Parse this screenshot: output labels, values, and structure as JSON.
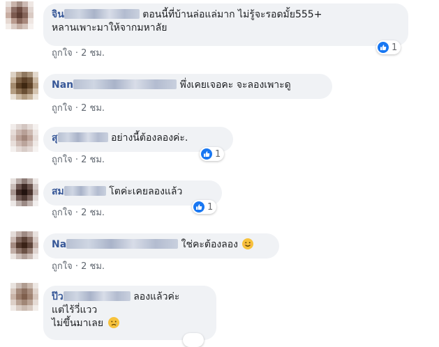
{
  "comments": [
    {
      "author": "จิน",
      "text_line1": "ตอนนี้ที่บ้านล่อแล่มาก ไม่รู้จะรอดมั้ย555+",
      "text_line2": "หลานเพาะมาให้จากมหาลัย",
      "like_label": "ถูกใจ",
      "time": "2 ชม.",
      "reaction_count": "1",
      "avatar_colors": [
        "#e8e0dc",
        "#c9b4ab",
        "#a58f86",
        "#cbb9b3",
        "#efe7e3",
        "#d7c2ba",
        "#8d6f66",
        "#6e4c42",
        "#9a7c72",
        "#e1d5d0",
        "#c7ada2",
        "#7c5a4f",
        "#5d3d33",
        "#846459",
        "#d9cac3",
        "#e6d9d2",
        "#b99b8f",
        "#8a695d",
        "#a8887c",
        "#efe6e2",
        "#f3ede9",
        "#dacbc4",
        "#c4aea4",
        "#d5c4bc",
        "#f6f1ee"
      ]
    },
    {
      "author": "Nan",
      "text_line1": "พึ่งเคยเจอคะ จะลองเพาะดู",
      "like_label": "ถูกใจ",
      "time": "2 ชม.",
      "avatar_colors": [
        "#dcd1c4",
        "#b49f87",
        "#8f7860",
        "#a8937b",
        "#e2d8cc",
        "#c6b29b",
        "#7a5f44",
        "#5d4128",
        "#6f553b",
        "#cdbba6",
        "#a38a6e",
        "#5b3f24",
        "#3f2812",
        "#604429",
        "#b69f85",
        "#b59e83",
        "#8a6e51",
        "#6a4f34",
        "#8c7257",
        "#d4c4b1",
        "#e9e1d7",
        "#cbb9a4",
        "#b19b81",
        "#c7b49d",
        "#ece5dc"
      ]
    },
    {
      "author": "สุ",
      "text_line1": "อย่างนี้ต้องลองค่ะ.",
      "like_label": "ถูกใจ",
      "time": "2 ชม.",
      "reaction_count": "1",
      "avatar_colors": [
        "#f1ecea",
        "#e0d6d2",
        "#d3c6c1",
        "#e4dbd7",
        "#f5f1ef",
        "#e6dcd8",
        "#c9b5ae",
        "#b8a097",
        "#cdbab2",
        "#ede6e3",
        "#dccec9",
        "#b99f95",
        "#a2867b",
        "#bfa59b",
        "#e6dcd8",
        "#e8dfdb",
        "#cdbab3",
        "#bba59c",
        "#d0beb7",
        "#efe9e6",
        "#f4f0ee",
        "#e4dad6",
        "#d8ccc7",
        "#e3d9d5",
        "#f6f3f1"
      ]
    },
    {
      "author": "สม",
      "text_line1": "โตค่ะเคยลองแล้ว",
      "like_label": "ถูกใจ",
      "time": "2 ชม.",
      "reaction_count": "1",
      "avatar_colors": [
        "#e6e0de",
        "#b7aaa6",
        "#8c7a75",
        "#b4a6a1",
        "#ece7e5",
        "#c9bdb9",
        "#6b5550",
        "#3e2a25",
        "#6a544e",
        "#d2c8c5",
        "#a89691",
        "#3c2722",
        "#22130f",
        "#4a342e",
        "#c2b4b0",
        "#c8bcb8",
        "#6e5853",
        "#4f3a34",
        "#7b6660",
        "#e1dad8",
        "#ece8e6",
        "#bdb1ad",
        "#9b8a85",
        "#c0b3af",
        "#f1eeed"
      ]
    },
    {
      "author": "Na",
      "text_line1": "ใช่คะต้องลอง",
      "like_label": "ถูกใจ",
      "time": "2 ชม.",
      "avatar_colors": [
        "#e4dcd9",
        "#c0afa9",
        "#9f8b84",
        "#bba9a2",
        "#e8e1de",
        "#cbbab4",
        "#7f665d",
        "#5c4237",
        "#83695f",
        "#d8cbc6",
        "#a48b82",
        "#543a2f",
        "#3a2217",
        "#5e443a",
        "#c6b3ac",
        "#c2afa8",
        "#8f766c",
        "#6c5246",
        "#947b71",
        "#dfd4d0",
        "#ebe5e2",
        "#cdbfba",
        "#b3a19a",
        "#cbbcb6",
        "#f0ebe9"
      ]
    },
    {
      "author": "ป๊ว",
      "text_line1": "ลองแล้วค่ะ",
      "text_line2": "แต่ไร้วี่แวว",
      "text_line3": "ไม่ขึ้นมาเลย",
      "avatar_colors": [
        "#e9e3df",
        "#cbbdb5",
        "#b09c90",
        "#cab9ae",
        "#ede7e3",
        "#d7c8bf",
        "#a58b7c",
        "#8c6f5f",
        "#a98f80",
        "#e0d4cd",
        "#c9b4a8",
        "#9a7c6b",
        "#7f5f4d",
        "#9f8271",
        "#d6c6bd",
        "#ddd0c8",
        "#b7a092",
        "#a18777",
        "#baa395",
        "#e5dbd5",
        "#efe9e5",
        "#d9ccc4",
        "#cbbbb1",
        "#d8cac1",
        "#f2ede9"
      ]
    }
  ],
  "colors": {
    "author": "#385898",
    "bubble": "#f0f2f5",
    "meta": "#606770",
    "like_blue": "#1877f2"
  }
}
